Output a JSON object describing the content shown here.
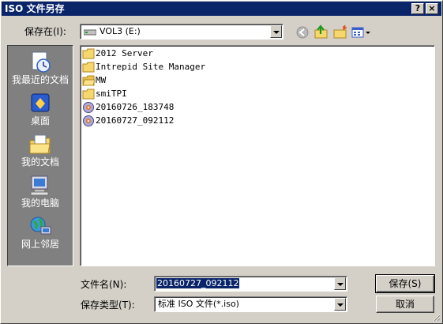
{
  "window": {
    "title": "ISO 文件另存",
    "help_button": "?",
    "close_button": "×"
  },
  "save_in": {
    "label": "保存在(I):",
    "value": "VOL3 (E:)"
  },
  "toolbar": {
    "back_icon": "back-arrow-icon",
    "up_icon": "up-folder-icon",
    "new_folder_icon": "new-folder-icon",
    "views_icon": "views-menu-icon"
  },
  "places": [
    {
      "label": "我最近的文档",
      "icon": "recent-documents-icon"
    },
    {
      "label": "桌面",
      "icon": "desktop-icon"
    },
    {
      "label": "我的文档",
      "icon": "my-documents-icon"
    },
    {
      "label": "我的电脑",
      "icon": "my-computer-icon"
    },
    {
      "label": "网上邻居",
      "icon": "network-places-icon"
    }
  ],
  "files": [
    {
      "name": "2012 Server",
      "type": "folder"
    },
    {
      "name": "Intrepid Site Manager",
      "type": "folder"
    },
    {
      "name": "MW",
      "type": "folder-open"
    },
    {
      "name": "smiTPI",
      "type": "folder"
    },
    {
      "name": "20160726_183748",
      "type": "disc"
    },
    {
      "name": "20160727_092112",
      "type": "disc"
    }
  ],
  "filename": {
    "label": "文件名(N):",
    "value": "20160727_092112"
  },
  "filetype": {
    "label": "保存类型(T):",
    "value": "标准 ISO 文件(*.iso)"
  },
  "buttons": {
    "save": "保存(S)",
    "cancel": "取消"
  },
  "colors": {
    "titlebar": "#0a246a",
    "face": "#d4d0c8",
    "places_bg": "#808080",
    "folder": "#f5d76e"
  }
}
